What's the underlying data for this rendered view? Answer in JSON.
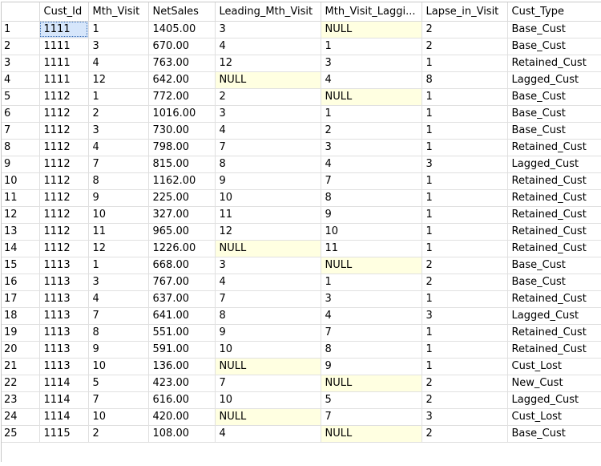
{
  "grid": {
    "columns": [
      "",
      "Cust_Id",
      "Mth_Visit",
      "NetSales",
      "Leading_Mth_Visit",
      "Mth_Visit_Laggi...",
      "Lapse_in_Visit",
      "Cust_Type"
    ],
    "rows": [
      [
        "1",
        "1111",
        "1",
        "1405.00",
        "3",
        "NULL",
        "2",
        "Base_Cust"
      ],
      [
        "2",
        "1111",
        "3",
        "670.00",
        "4",
        "1",
        "2",
        "Base_Cust"
      ],
      [
        "3",
        "1111",
        "4",
        "763.00",
        "12",
        "3",
        "1",
        "Retained_Cust"
      ],
      [
        "4",
        "1111",
        "12",
        "642.00",
        "NULL",
        "4",
        "8",
        "Lagged_Cust"
      ],
      [
        "5",
        "1112",
        "1",
        "772.00",
        "2",
        "NULL",
        "1",
        "Base_Cust"
      ],
      [
        "6",
        "1112",
        "2",
        "1016.00",
        "3",
        "1",
        "1",
        "Base_Cust"
      ],
      [
        "7",
        "1112",
        "3",
        "730.00",
        "4",
        "2",
        "1",
        "Base_Cust"
      ],
      [
        "8",
        "1112",
        "4",
        "798.00",
        "7",
        "3",
        "1",
        "Retained_Cust"
      ],
      [
        "9",
        "1112",
        "7",
        "815.00",
        "8",
        "4",
        "3",
        "Lagged_Cust"
      ],
      [
        "10",
        "1112",
        "8",
        "1162.00",
        "9",
        "7",
        "1",
        "Retained_Cust"
      ],
      [
        "11",
        "1112",
        "9",
        "225.00",
        "10",
        "8",
        "1",
        "Retained_Cust"
      ],
      [
        "12",
        "1112",
        "10",
        "327.00",
        "11",
        "9",
        "1",
        "Retained_Cust"
      ],
      [
        "13",
        "1112",
        "11",
        "965.00",
        "12",
        "10",
        "1",
        "Retained_Cust"
      ],
      [
        "14",
        "1112",
        "12",
        "1226.00",
        "NULL",
        "11",
        "1",
        "Retained_Cust"
      ],
      [
        "15",
        "1113",
        "1",
        "668.00",
        "3",
        "NULL",
        "2",
        "Base_Cust"
      ],
      [
        "16",
        "1113",
        "3",
        "767.00",
        "4",
        "1",
        "2",
        "Base_Cust"
      ],
      [
        "17",
        "1113",
        "4",
        "637.00",
        "7",
        "3",
        "1",
        "Retained_Cust"
      ],
      [
        "18",
        "1113",
        "7",
        "641.00",
        "8",
        "4",
        "3",
        "Lagged_Cust"
      ],
      [
        "19",
        "1113",
        "8",
        "551.00",
        "9",
        "7",
        "1",
        "Retained_Cust"
      ],
      [
        "20",
        "1113",
        "9",
        "591.00",
        "10",
        "8",
        "1",
        "Retained_Cust"
      ],
      [
        "21",
        "1113",
        "10",
        "136.00",
        "NULL",
        "9",
        "1",
        "Cust_Lost"
      ],
      [
        "22",
        "1114",
        "5",
        "423.00",
        "7",
        "NULL",
        "2",
        "New_Cust"
      ],
      [
        "23",
        "1114",
        "7",
        "616.00",
        "10",
        "5",
        "2",
        "Lagged_Cust"
      ],
      [
        "24",
        "1114",
        "10",
        "420.00",
        "NULL",
        "7",
        "3",
        "Cust_Lost"
      ],
      [
        "25",
        "1115",
        "2",
        "108.00",
        "4",
        "NULL",
        "2",
        "Base_Cust"
      ]
    ],
    "null_text": "NULL",
    "selected_cell": {
      "row": 0,
      "col": 1
    },
    "colors": {
      "null_bg": "#ffffe1",
      "selected_bg": "#d6e6fb",
      "grid_line": "#e0e0e0"
    }
  }
}
